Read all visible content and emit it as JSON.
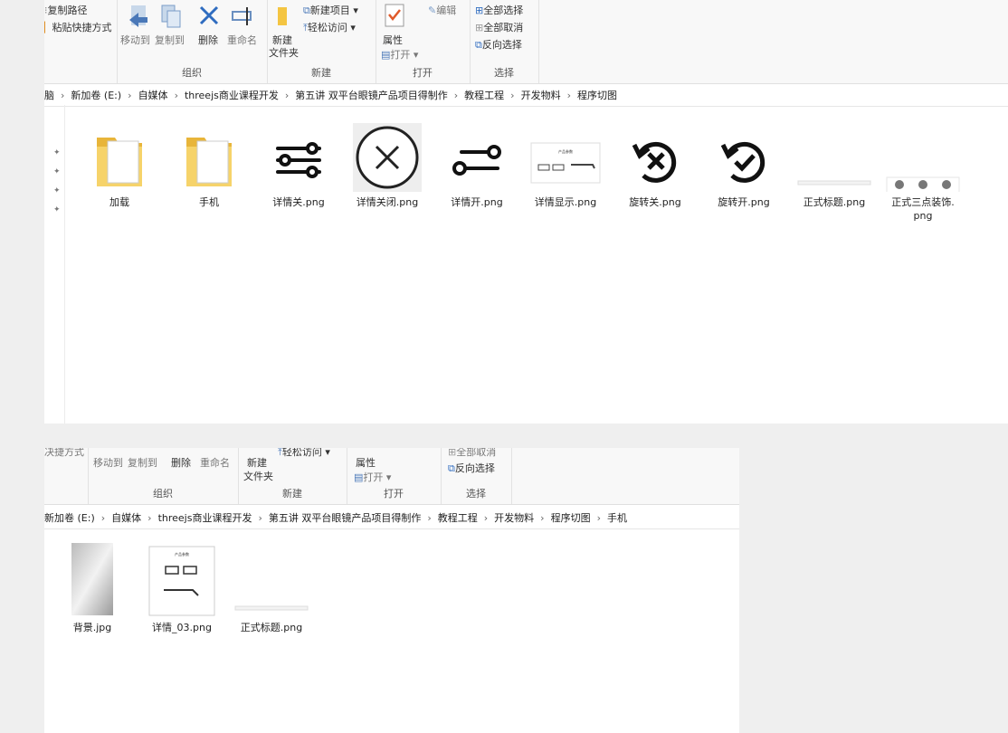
{
  "win1": {
    "ribbon": {
      "clipboard": {
        "copy_path": "复制路径",
        "paste_shortcut": "粘贴快捷方式"
      },
      "organize": {
        "label": "组织",
        "move_to": "移动到",
        "copy_to": "复制到",
        "delete": "删除",
        "rename": "重命名"
      },
      "new": {
        "label": "新建",
        "new_folder_line1": "新建",
        "new_folder_line2": "文件夹",
        "new_item": "新建项目 ▾",
        "easy_access": "轻松访问 ▾"
      },
      "open": {
        "label": "打开",
        "properties": "属性",
        "open": "打开 ▾",
        "edit": "编辑"
      },
      "select": {
        "label": "选择",
        "select_all": "全部选择",
        "select_none": "全部取消",
        "invert": "反向选择"
      }
    },
    "breadcrumb": [
      "脑",
      "新加卷 (E:)",
      "自媒体",
      "threejs商业课程开发",
      "第五讲 双平台眼镜产品项目得制作",
      "教程工程",
      "开发物料",
      "程序切图"
    ],
    "files": [
      {
        "name": "加载",
        "icon": "folder-icon"
      },
      {
        "name": "手机",
        "icon": "folder-icon"
      },
      {
        "name": "详情关.png",
        "icon": "sliders-off-icon"
      },
      {
        "name": "详情关闭.png",
        "icon": "close-circle-icon"
      },
      {
        "name": "详情开.png",
        "icon": "toggle-icon"
      },
      {
        "name": "详情显示.png",
        "icon": "product-card-icon"
      },
      {
        "name": "旋转关.png",
        "icon": "rotate-x-icon"
      },
      {
        "name": "旋转开.png",
        "icon": "rotate-check-icon"
      },
      {
        "name": "正式标题.png",
        "icon": "title-strip-icon"
      },
      {
        "name": "正式三点装饰.",
        "name2": "png",
        "icon": "three-dots-icon"
      }
    ],
    "product_card_text": "产品参数"
  },
  "win2": {
    "ribbon": {
      "clipboard": {
        "shortcut": "决捷方式"
      },
      "organize": {
        "label": "组织",
        "move_to": "移动到",
        "copy_to": "复制到",
        "delete": "删除",
        "rename": "重命名"
      },
      "new": {
        "label": "新建",
        "new_folder_line1": "新建",
        "new_folder_line2": "文件夹",
        "easy_access": "轻松访问 ▾"
      },
      "open": {
        "label": "打开",
        "properties": "属性",
        "open": "打开 ▾"
      },
      "select": {
        "label": "选择",
        "select_none": "全部取消",
        "invert": "反向选择"
      }
    },
    "breadcrumb": [
      "新加卷 (E:)",
      "自媒体",
      "threejs商业课程开发",
      "第五讲 双平台眼镜产品项目得制作",
      "教程工程",
      "开发物料",
      "程序切图",
      "手机"
    ],
    "files": [
      {
        "name": "背景.jpg",
        "icon": "background-image-icon"
      },
      {
        "name": "详情_03.png",
        "icon": "product-detail-icon"
      },
      {
        "name": "正式标题.png",
        "icon": "title-strip-icon"
      }
    ],
    "product_card_text": "产品参数"
  },
  "colors": {
    "accent": "#1e73c8",
    "folder": "#f4c542",
    "check": "#e05a2a"
  }
}
